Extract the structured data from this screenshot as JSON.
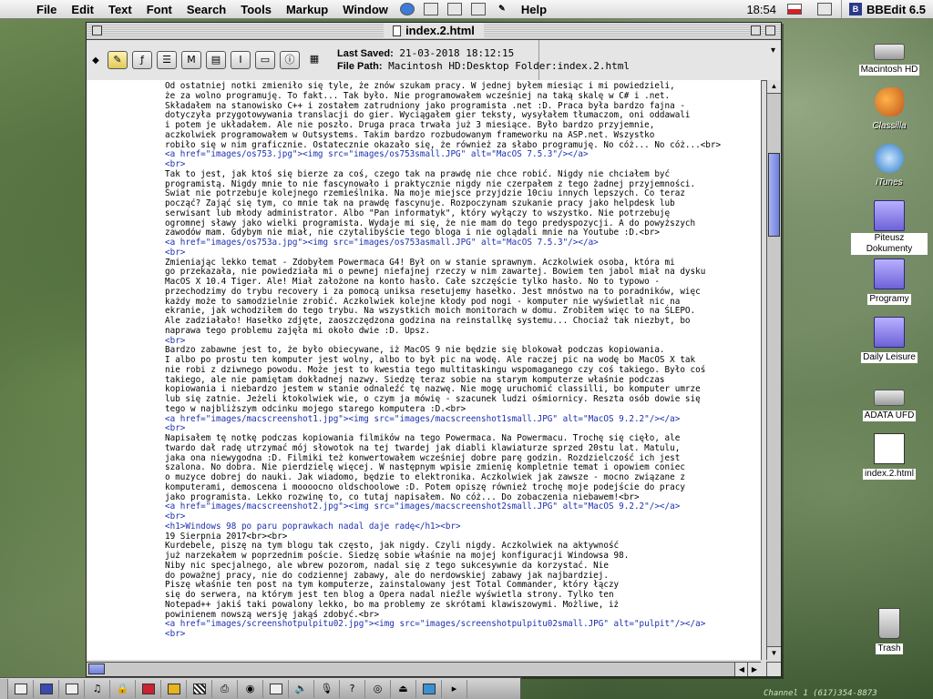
{
  "menubar": {
    "items": [
      "File",
      "Edit",
      "Text",
      "Font",
      "Search",
      "Tools",
      "Markup",
      "Window",
      "Help"
    ],
    "clock": "18:54",
    "active_app": "BBEdit 6.5"
  },
  "window": {
    "title": "index.2.html",
    "last_saved_label": "Last Saved:",
    "last_saved_value": "21-03-2018 18:12:15",
    "file_path_label": "File Path:",
    "file_path_value": "Macintosh HD:Desktop Folder:index.2.html"
  },
  "toolbar": {
    "buttons": [
      "pencil",
      "f",
      "list",
      "M",
      "doc",
      "I",
      "folder",
      "info"
    ]
  },
  "editor": {
    "lines": [
      "Od ostatniej notki zmieniło się tyle, że znów szukam pracy. W jednej byłem miesiąc i mi powiedzieli,",
      "że za wolno programuję. To fakt... Tak było. Nie programowałem wcześniej na taką skalę w C# i .net.",
      "Składałem na stanowisko C++ i zostałem zatrudniony jako programista .net :D. Praca była bardzo fajna -",
      "dotyczyła przygotowywania translacji do gier. Wyciągałem gier teksty, wysyłałem tłumaczom, oni oddawali",
      "i potem je układałem. Ale nie poszło. Druga praca trwała już 3 miesiące. Było bardzo przyjemnie,",
      "aczkolwiek programowałem w Outsystems. Takim bardzo rozbudowanym frameworku na ASP.net. Wszystko",
      "robiło się w nim graficznie. Ostatecznie okazało się, że również za słabo programuję. No cóż... No cóż...<br>",
      "<a href=\"images/os753.jpg\"><img src=\"images/os753small.JPG\" alt=\"MacOS 7.5.3\"/></a>",
      "<br>",
      "Tak to jest, jak ktoś się bierze za coś, czego tak na prawdę nie chce robić. Nigdy nie chciałem być",
      "programistą. Nigdy mnie to nie fascynowało i praktycznie nigdy nie czerpałem z tego żadnej przyjemności.",
      "Świat nie potrzebuje kolejnego rzemieślnika. Na moje miejsce przyjdzie 10ciu innych lepszych. Co teraz",
      "począć? Zająć się tym, co mnie tak na prawdę fascynuje. Rozpoczynam szukanie pracy jako helpdesk lub",
      "serwisant lub młody administrator. Albo \"Pan informatyk\", który wyłączy to wszystko. Nie potrzebuję",
      "ogromnej sławy jako wielki programista. Wydaje mi się, że nie mam do tego predyspozycji. A do powyższych",
      "zawodów mam. Gdybym nie miał, nie czytalibyście tego bloga i nie oglądali mnie na Youtube :D.<br>",
      "<a href=\"images/os753a.jpg\"><img src=\"images/os753asmall.JPG\" alt=\"MacOS 7.5.3\"/></a>",
      "<br>",
      "Zmieniając lekko temat - Zdobyłem Powermaca G4! Był on w stanie sprawnym. Aczkolwiek osoba, która mi",
      "go przekazała, nie powiedziała mi o pewnej niefajnej rzeczy w nim zawartej. Bowiem ten jabol miał na dysku",
      "MacOS X 10.4 Tiger. Ale! Miał założone na konto hasło. Całe szczęście tylko hasło. No to typowo -",
      "przechodzimy do trybu recovery i za pomocą uniksa resetujemy hasełko. Jest mnóstwo na to poradników, więc",
      "każdy może to samodzielnie zrobić. Aczkolwiek kolejne kłody pod nogi - komputer nie wyświetlał nic na",
      "ekranie, jak wchodziłem do tego trybu. Na wszystkich moich monitorach w domu. Zrobiłem więc to na ŚLEPO.",
      "Ale zadziałało! Hasełko zdjęte, zaoszczędzona godzina na reinstallkę systemu... Chociaż tak niezbyt, bo",
      "naprawa tego problemu zajęła mi około dwie :D. Upsz.",
      "<br>",
      "Bardzo zabawne jest to, że było obiecywane, iż MacOS 9 nie będzie się blokował podczas kopiowania.",
      "I albo po prostu ten komputer jest wolny, albo to był pic na wodę. Ale raczej pic na wodę bo MacOS X tak",
      "nie robi z dziwnego powodu. Może jest to kwestia tego multitaskingu wspomaganego czy coś takiego. Było coś",
      "takiego, ale nie pamiętam dokładnej nazwy. Siedzę teraz sobie na starym komputerze właśnie podczas",
      "kopiowania i niebardzo jestem w stanie odnaleźć tę nazwę. Nie mogę uruchomić classilli, bo komputer umrze",
      "lub się zatnie. Jeżeli ktokolwiek wie, o czym ja mówię - szacunek ludzi ośmiornicy. Reszta osób dowie się",
      "tego w najbliższym odcinku mojego starego komputera :D.<br>",
      "<a href=\"images/macscreenshot1.jpg\"><img src=\"images/macscreenshot1small.JPG\" alt=\"MacOS 9.2.2\"/></a>",
      "<br>",
      "Napisałem tę notkę podczas kopiowania filmików na tego Powermaca. Na Powermacu. Trochę się cięło, ale",
      "twardo dał radę utrzymać mój słowotok na tej twardej jak diabli klawiaturze sprzed 20stu lat. Matulu,",
      "jaka ona niewygodna :D. Filmiki też konwertowałem wcześniej dobre parę godzin. Rozdzielczość ich jest",
      "szalona. No dobra. Nie pierdzielę więcej. W następnym wpisie zmienię kompletnie temat i opowiem coniec",
      "o muzyce dobrej do nauki. Jak wiadomo, będzie to elektronika. Aczkolwiek jak zawsze - mocno związane z",
      "komputerami, demoscena i moooocno oldschoolowe :D. Potem opiszę również trochę moje podejście do pracy",
      "jako programista. Lekko rozwinę to, co tutaj napisałem. No cóż... Do zobaczenia niebawem!<br>",
      "<a href=\"images/macscreenshot2.jpg\"><img src=\"images/macscreenshot2small.JPG\" alt=\"MacOS 9.2.2\"/></a>",
      "<br>",
      "<h1>Windows 98 po paru poprawkach nadal daje radę</h1><br>",
      "19 Sierpnia 2017<br><br>",
      "Kurdebele, piszę na tym blogu tak często, jak nigdy. Czyli nigdy. Aczkolwiek na aktywność",
      "już narzekałem w poprzednim poście. Siedzę sobie właśnie na mojej konfiguracji Windowsa 98.",
      "Niby nic specjalnego, ale wbrew pozorom, nadal się z tego sukcesywnie da korzystać. Nie",
      "do poważnej pracy, nie do codziennej zabawy, ale do nerdowskiej zabawy jak najbardziej.",
      "Piszę właśnie ten post na tym komputerze, zainstalowany jest Total Commander, który łączy",
      "się do serwera, na którym jest ten blog a Opera nadal nieźle wyświetla strony. Tylko ten",
      "Notepad++ jakiś taki powalony lekko, bo ma problemy ze skrótami klawiszowymi. Możliwe, iż",
      "powinienem nowszą wersję jakąś zdobyć.<br>",
      "<a href=\"images/screenshotpulpitu02.jpg\"><img src=\"images/screenshotpulpitu02small.JPG\" alt=\"pulpit\"/></a>",
      "<br>"
    ]
  },
  "desktop": {
    "icons": [
      {
        "label": "Macintosh HD",
        "kind": "hard-disk"
      },
      {
        "label": "Classilla",
        "kind": "app"
      },
      {
        "label": "iTunes",
        "kind": "app"
      },
      {
        "label": "Piteusz Dokumenty",
        "kind": "folder"
      },
      {
        "label": "Programy",
        "kind": "folder"
      },
      {
        "label": "Daily Leisure",
        "kind": "folder"
      },
      {
        "label": "ADATA UFD",
        "kind": "drive"
      },
      {
        "label": "index.2.html",
        "kind": "document"
      },
      {
        "label": "Trash",
        "kind": "trash"
      }
    ],
    "channel_text": "Channel 1 (617)354-8873"
  }
}
